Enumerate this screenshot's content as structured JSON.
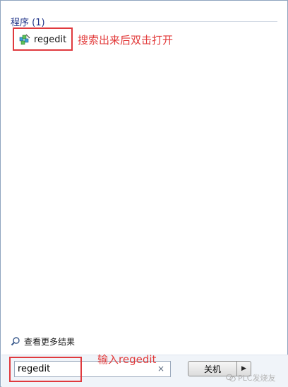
{
  "programs": {
    "header": "程序 (1)",
    "items": [
      {
        "label": "regedit",
        "icon": "regedit-icon"
      }
    ]
  },
  "annotations": {
    "result_hint": "搜索出来后双击打开",
    "search_hint": "输入regedit"
  },
  "see_more": {
    "label": "查看更多结果",
    "icon": "magnifier-icon"
  },
  "search": {
    "value": "regedit",
    "clear_symbol": "×"
  },
  "shutdown": {
    "label": "关机",
    "arrow": "▶"
  },
  "watermark": {
    "text": "PLC发烧友"
  },
  "colors": {
    "annotation_red": "#e23a3a",
    "header_blue": "#1e3287"
  }
}
